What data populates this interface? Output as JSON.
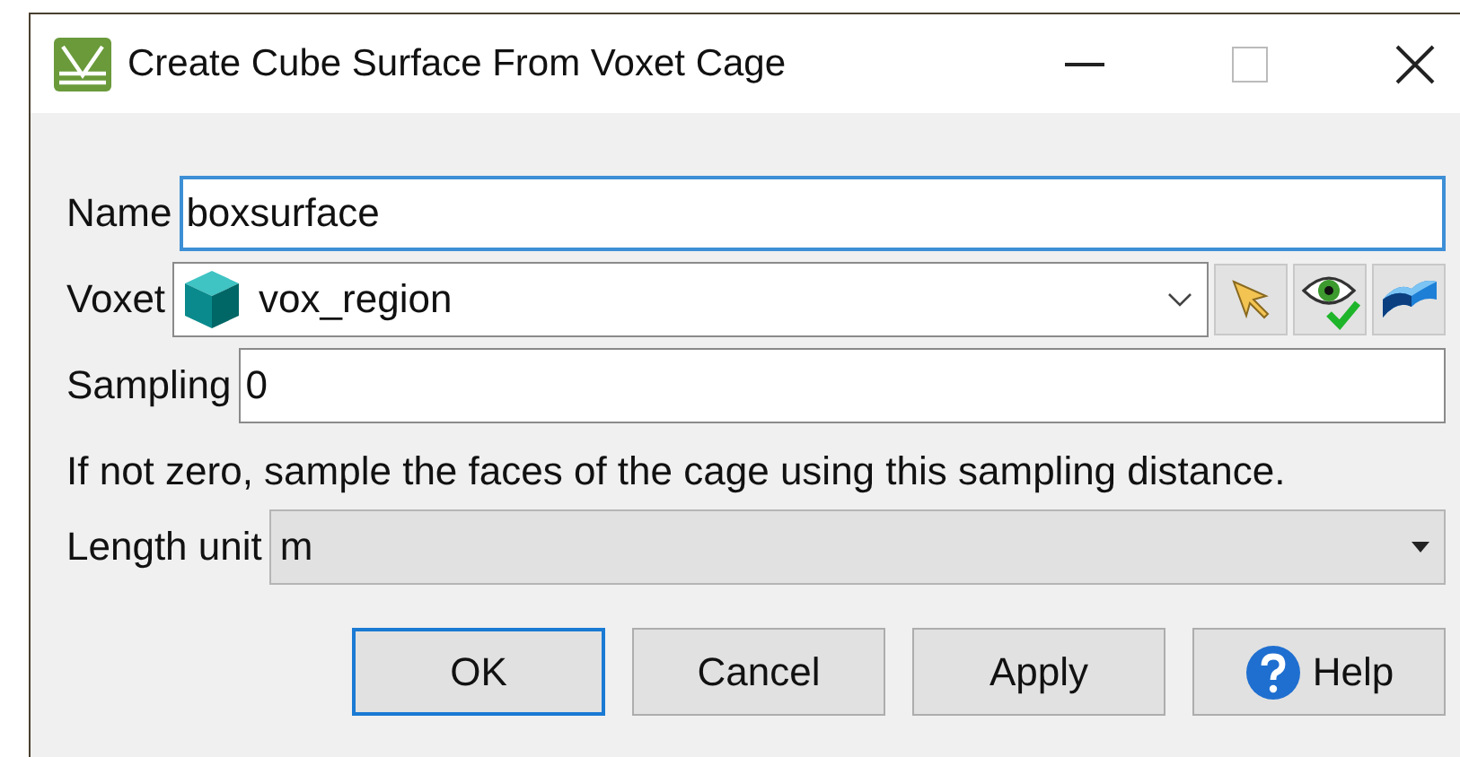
{
  "window": {
    "title": "Create Cube Surface From Voxet Cage"
  },
  "fields": [
    {
      "kind": "text",
      "label": "Name",
      "value": "boxsurface",
      "focused": true
    },
    {
      "kind": "object-combo",
      "label": "Voxet",
      "value": "vox_region",
      "focused": false
    },
    {
      "kind": "text",
      "label": "Sampling",
      "value": "0",
      "focused": false
    }
  ],
  "hint": "If not zero, sample the faces of the cage using this sampling distance.",
  "length_unit": {
    "label": "Length unit",
    "value": "m"
  },
  "buttons": [
    {
      "label": "OK",
      "kind": "default"
    },
    {
      "label": "Cancel",
      "kind": "plain"
    },
    {
      "label": "Apply",
      "kind": "plain"
    },
    {
      "label": "Help",
      "kind": "help"
    }
  ]
}
